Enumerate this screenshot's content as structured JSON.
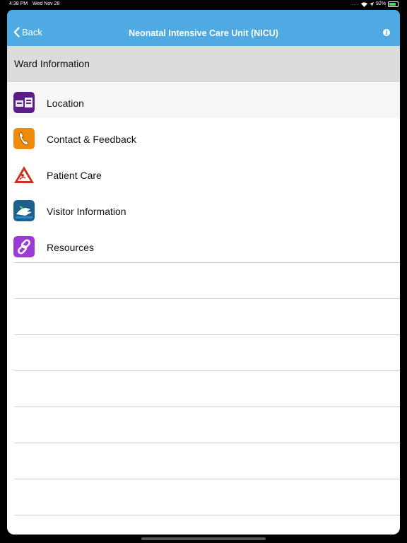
{
  "status": {
    "time": "4:38 PM",
    "date": "Wed Nov 28",
    "battery": "92%",
    "battery_level": 0.92
  },
  "nav": {
    "back_label": "Back",
    "title": "Neonatal Intensive Care Unit (NICU)",
    "info_icon": "info-icon"
  },
  "section": {
    "header": "Ward Information"
  },
  "items": [
    {
      "label": "Location",
      "icon": "location-icon",
      "color": "#5b1d8c"
    },
    {
      "label": "Contact & Feedback",
      "icon": "phone-icon",
      "color": "#f08a0b"
    },
    {
      "label": "Patient Care",
      "icon": "patient-care-icon",
      "color": "#c8321e"
    },
    {
      "label": "Visitor Information",
      "icon": "visitor-icon",
      "color": "#1f5f8b"
    },
    {
      "label": "Resources",
      "icon": "link-icon",
      "color": "#9b3bd6"
    }
  ],
  "colors": {
    "nav_bar": "#4fa9e3",
    "section_header": "#dcdcdc"
  }
}
